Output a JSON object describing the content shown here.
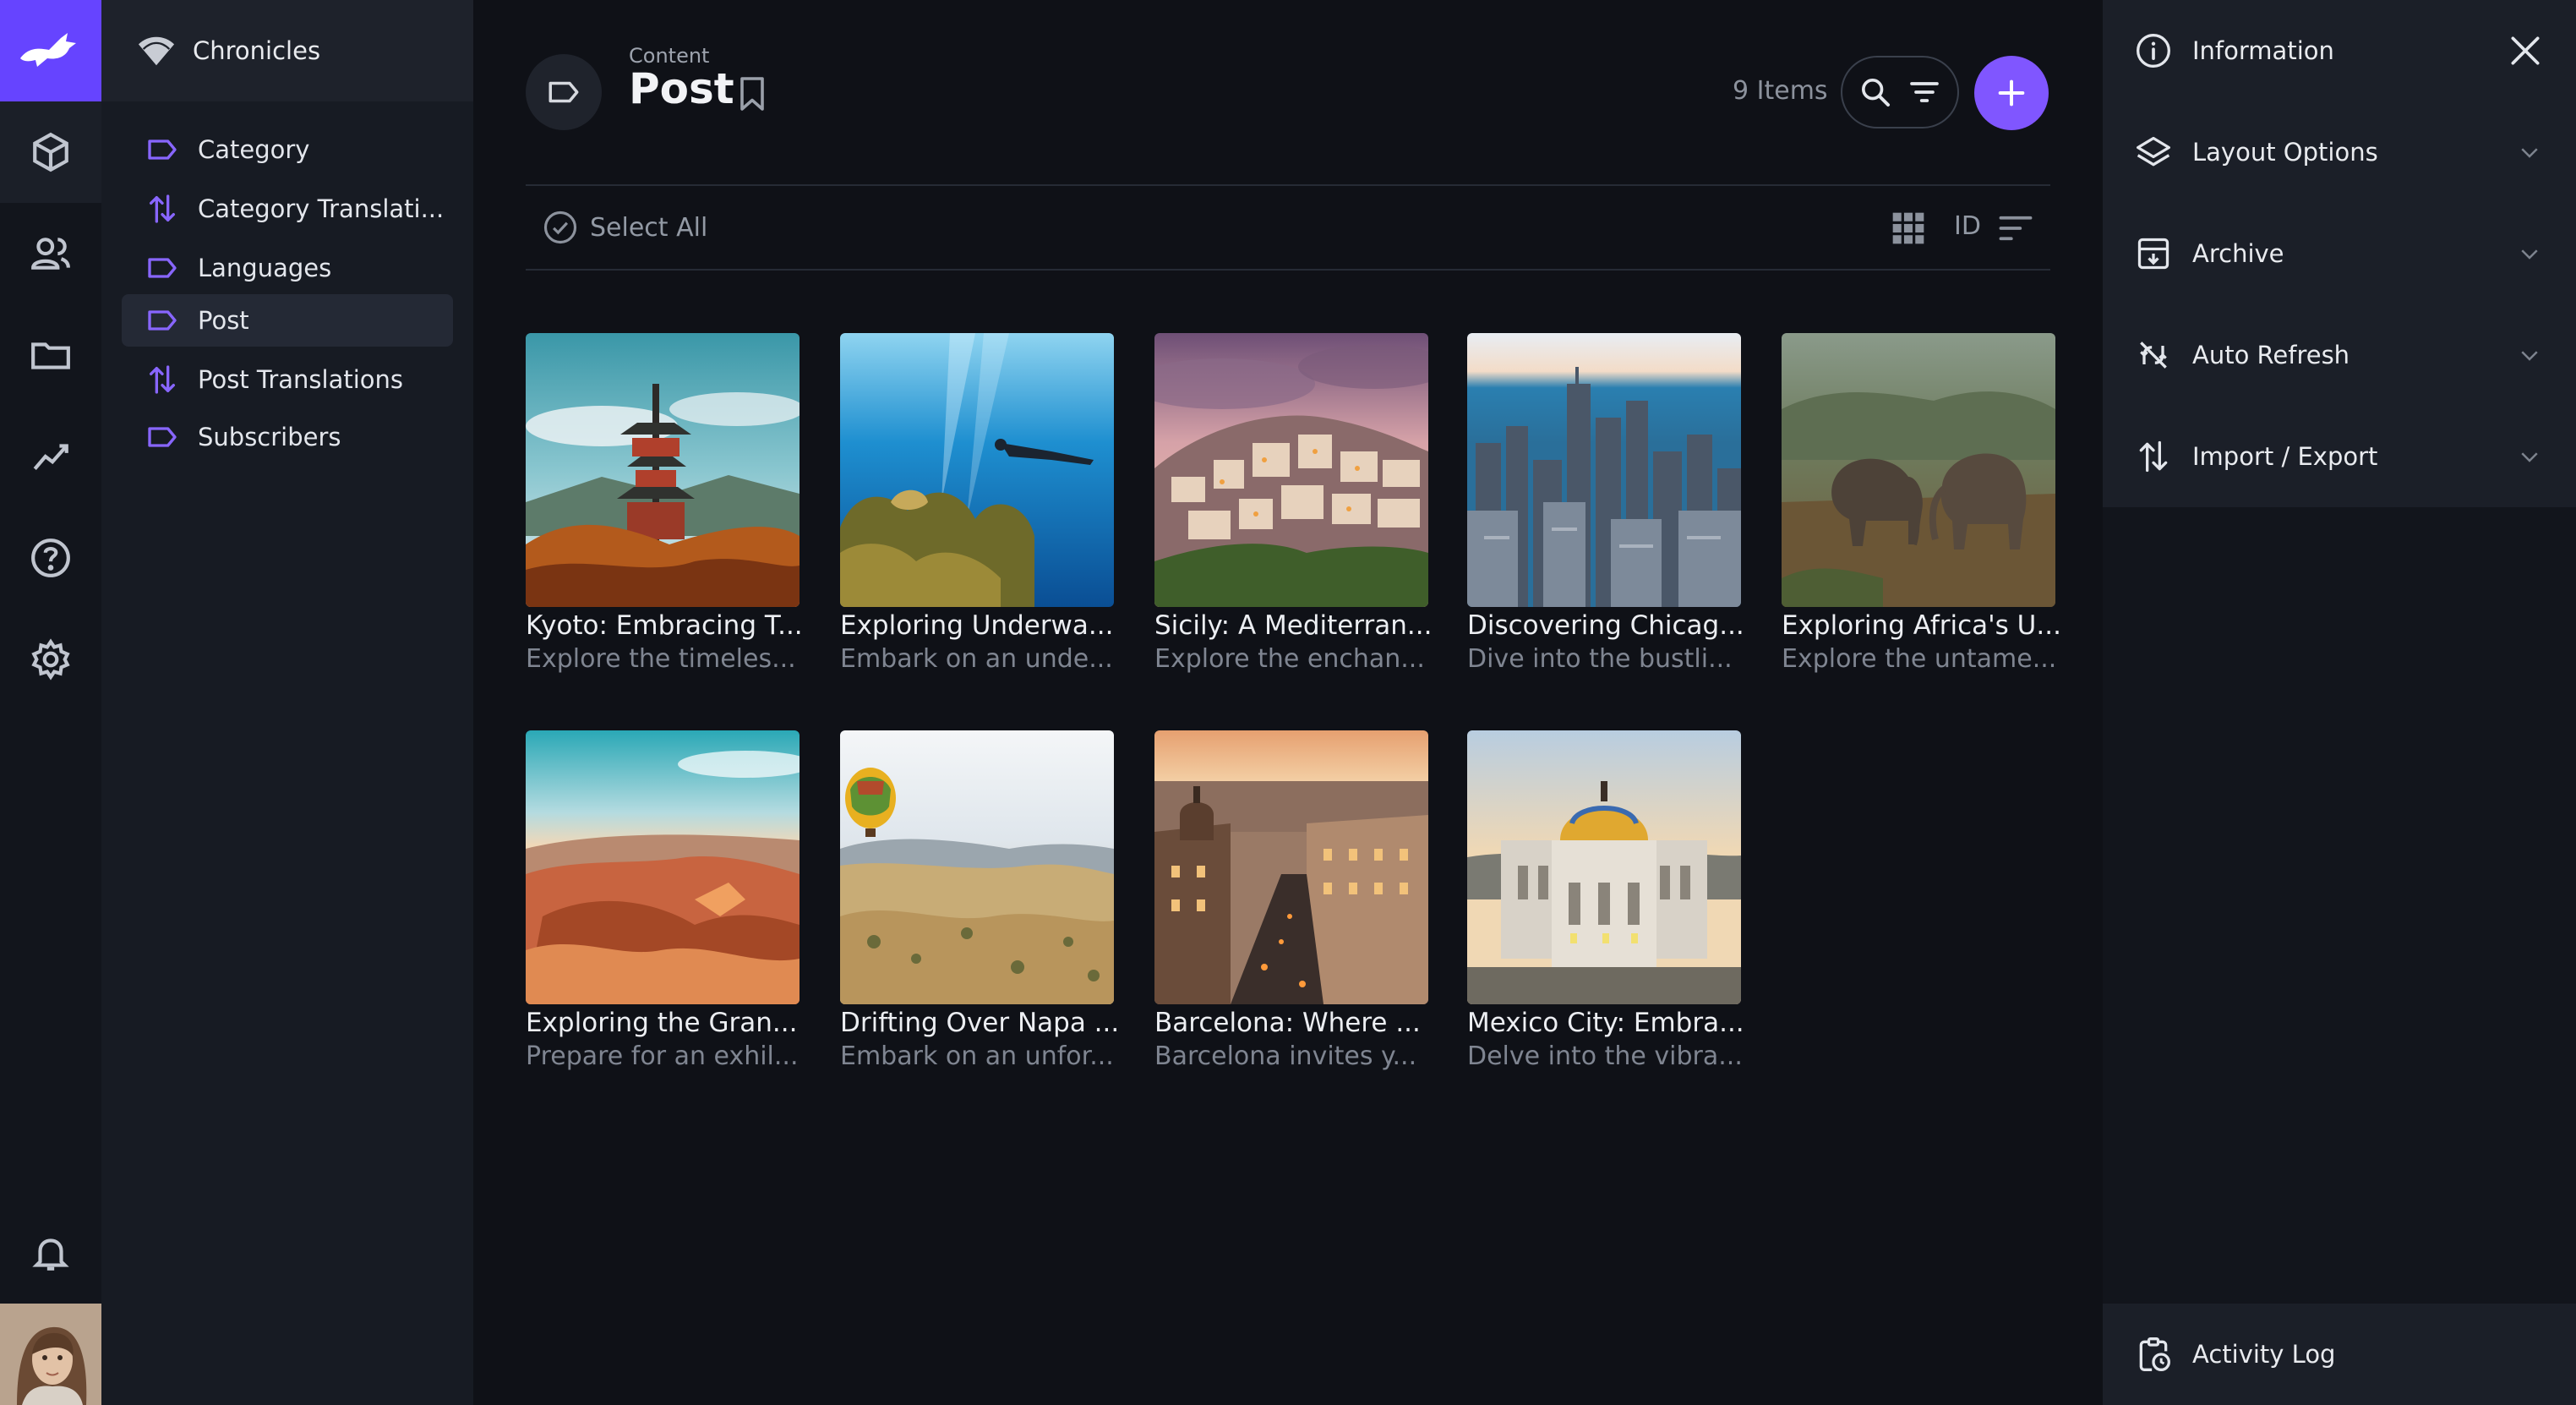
{
  "project": {
    "name": "Chronicles"
  },
  "navigation": {
    "items": [
      {
        "label": "Category",
        "icon": "label-icon"
      },
      {
        "label": "Category Translati...",
        "icon": "translations-icon"
      },
      {
        "label": "Languages",
        "icon": "label-icon"
      },
      {
        "label": "Post",
        "icon": "label-icon",
        "active": true
      },
      {
        "label": "Post Translations",
        "icon": "translations-icon"
      },
      {
        "label": "Subscribers",
        "icon": "label-icon"
      }
    ]
  },
  "modules": [
    "content-icon",
    "users-icon",
    "files-icon",
    "insights-icon",
    "help-icon",
    "settings-icon",
    "notifications-icon"
  ],
  "header": {
    "breadcrumb": "Content",
    "title": "Post",
    "item_count": "9 Items"
  },
  "toolbar": {
    "select_all": "Select All",
    "sort_field": "ID"
  },
  "cards": [
    {
      "title": "Kyoto: Embracing T...",
      "subtitle": "Explore the timeles..."
    },
    {
      "title": "Exploring Underwa...",
      "subtitle": "Embark on an unde..."
    },
    {
      "title": "Sicily: A Mediterran...",
      "subtitle": "Explore the enchan..."
    },
    {
      "title": "Discovering Chicag...",
      "subtitle": "Dive into the bustli..."
    },
    {
      "title": "Exploring Africa's U...",
      "subtitle": "Explore the untame..."
    },
    {
      "title": "Exploring the Gran...",
      "subtitle": "Prepare for an exhil..."
    },
    {
      "title": "Drifting Over Napa ...",
      "subtitle": "Embark on an unfor..."
    },
    {
      "title": "Barcelona: Where ...",
      "subtitle": "Barcelona invites y..."
    },
    {
      "title": "Mexico City: Embra...",
      "subtitle": "Delve into the vibra..."
    }
  ],
  "sidebar": {
    "sections": [
      {
        "label": "Information",
        "icon": "info-icon"
      },
      {
        "label": "Layout Options",
        "icon": "layers-icon"
      },
      {
        "label": "Archive",
        "icon": "archive-icon"
      },
      {
        "label": "Auto Refresh",
        "icon": "sync-disabled-icon"
      },
      {
        "label": "Import / Export",
        "icon": "import-export-icon"
      }
    ],
    "activity_log": "Activity Log"
  },
  "colors": {
    "accent": "#6644ff",
    "accent_button": "#8056ff",
    "nav_icon": "#8866ff"
  }
}
